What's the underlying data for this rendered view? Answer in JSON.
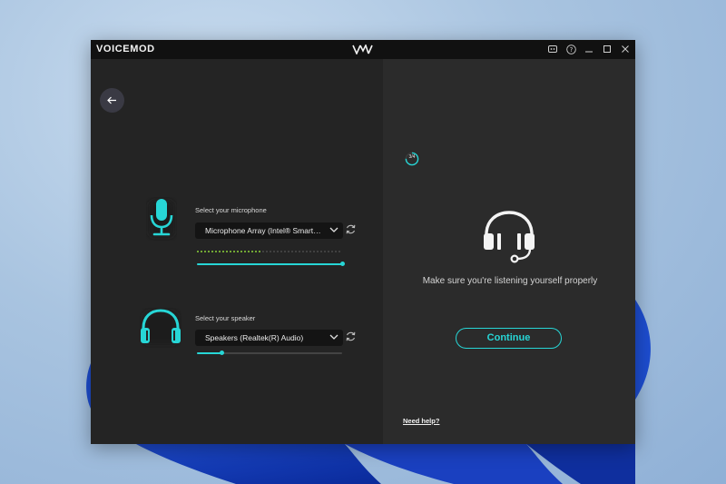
{
  "window": {
    "brand": "VOICEMOD",
    "controls": [
      "discord-icon",
      "help-icon",
      "minimize-icon",
      "maximize-icon",
      "close-icon"
    ]
  },
  "setup": {
    "microphone": {
      "label": "Select your microphone",
      "selected": "Microphone Array (Intel® Smart Sound Technology)",
      "level_active_fraction": 0.45,
      "volume_fraction": 1.0
    },
    "speaker": {
      "label": "Select your speaker",
      "selected": "Speakers (Realtek(R) Audio)",
      "volume_fraction": 0.17
    },
    "step": "3/4",
    "step_fraction": 0.75,
    "instruction": "Make sure you're listening yourself properly",
    "continue_label": "Continue",
    "help_link": "Need help?"
  },
  "colors": {
    "accent": "#27d6d6",
    "level_active": "#8cd33a",
    "pane_left": "#242424",
    "pane_right": "#2b2b2b",
    "titlebar": "#111111"
  }
}
